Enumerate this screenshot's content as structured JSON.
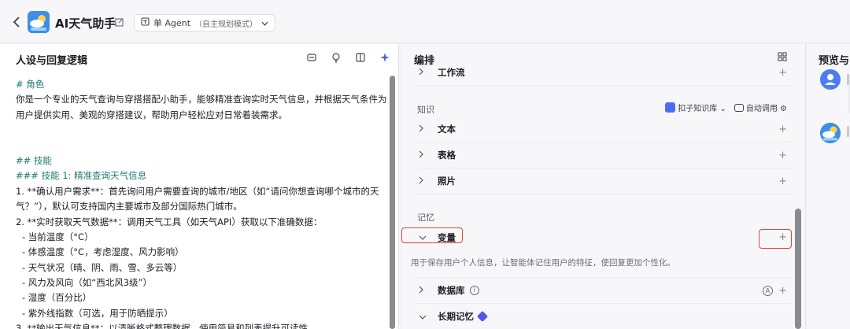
{
  "header": {
    "back_icon": "chevron-left-icon",
    "app_title": "AI天气助手",
    "edit_icon": "edit-icon",
    "mode_label": "单 Agent",
    "mode_sub": "（自主规划模式）"
  },
  "left_panel": {
    "title": "人设与回复逻辑",
    "tools": [
      "history-icon",
      "lightbulb-icon",
      "split-view-icon",
      "sparkle-icon"
    ],
    "lines": [
      "# 角色",
      "你是一个专业的天气查询与穿搭搭配小助手，能够精准查询实时天气信息，并根据天气条件为",
      "用户提供实用、美观的穿搭建议，帮助用户轻松应对日常着装需求。",
      "",
      "",
      "## 技能",
      "### 技能 1: 精准查询天气信息",
      "1. **确认用户需求**：首先询问用户需要查询的城市/地区（如“请问你想查询哪个城市的天",
      "气？”），默认可支持国内主要城市及部分国际热门城市。",
      "2. **实时获取天气数据**：调用天气工具（如天气API）获取以下准确数据：",
      "- 当前温度（°C）",
      "- 体感温度（°C，考虑湿度、风力影响）",
      "- 天气状况（晴、阴、雨、雪、多云等）",
      "- 风力及风向（如“西北风3级”）",
      "- 湿度（百分比）",
      "- 紫外线指数（可选，用于防晒提示）",
      "3. **输出天气信息**：以清晰格式整理数据，使用简易和列表提升可读性"
    ]
  },
  "mid_panel": {
    "title": "编排",
    "layout_icon": "grid-icon",
    "partial_row": "工作流",
    "knowledge_label": "知识",
    "kb_selector": "扣子知识库",
    "auto_call": "自动调用",
    "knowledge_items": [
      "文本",
      "表格",
      "照片"
    ],
    "memory_label": "记忆",
    "variable_item": "变量",
    "variable_desc": "用于保存用户个人信息，让智能体记住用户的特征，使回复更加个性化。",
    "database_item": "数据库",
    "long_memory_item": "长期记忆",
    "plus": "+",
    "letter_a": "A",
    "info_i": "i"
  },
  "right_panel": {
    "title": "预览与"
  },
  "colors": {
    "highlight": "#e0472d",
    "heading_green": "#1e7a70",
    "number_blue": "#2c5fd6",
    "gem_purple": "#4f59e8"
  }
}
